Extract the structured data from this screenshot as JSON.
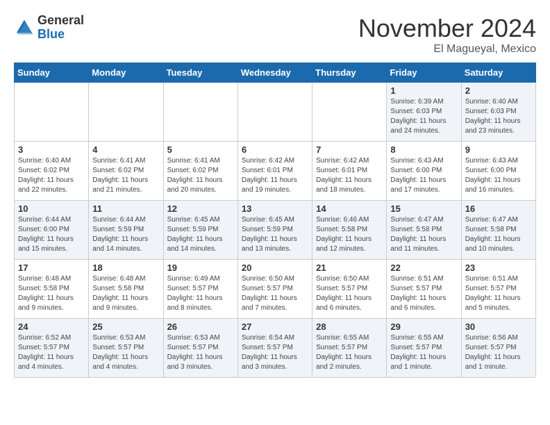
{
  "header": {
    "logo_general": "General",
    "logo_blue": "Blue",
    "month_title": "November 2024",
    "location": "El Magueyal, Mexico"
  },
  "days_of_week": [
    "Sunday",
    "Monday",
    "Tuesday",
    "Wednesday",
    "Thursday",
    "Friday",
    "Saturday"
  ],
  "weeks": [
    [
      {
        "day": "",
        "info": ""
      },
      {
        "day": "",
        "info": ""
      },
      {
        "day": "",
        "info": ""
      },
      {
        "day": "",
        "info": ""
      },
      {
        "day": "",
        "info": ""
      },
      {
        "day": "1",
        "info": "Sunrise: 6:39 AM\nSunset: 6:03 PM\nDaylight: 11 hours and 24 minutes."
      },
      {
        "day": "2",
        "info": "Sunrise: 6:40 AM\nSunset: 6:03 PM\nDaylight: 11 hours and 23 minutes."
      }
    ],
    [
      {
        "day": "3",
        "info": "Sunrise: 6:40 AM\nSunset: 6:02 PM\nDaylight: 11 hours and 22 minutes."
      },
      {
        "day": "4",
        "info": "Sunrise: 6:41 AM\nSunset: 6:02 PM\nDaylight: 11 hours and 21 minutes."
      },
      {
        "day": "5",
        "info": "Sunrise: 6:41 AM\nSunset: 6:02 PM\nDaylight: 11 hours and 20 minutes."
      },
      {
        "day": "6",
        "info": "Sunrise: 6:42 AM\nSunset: 6:01 PM\nDaylight: 11 hours and 19 minutes."
      },
      {
        "day": "7",
        "info": "Sunrise: 6:42 AM\nSunset: 6:01 PM\nDaylight: 11 hours and 18 minutes."
      },
      {
        "day": "8",
        "info": "Sunrise: 6:43 AM\nSunset: 6:00 PM\nDaylight: 11 hours and 17 minutes."
      },
      {
        "day": "9",
        "info": "Sunrise: 6:43 AM\nSunset: 6:00 PM\nDaylight: 11 hours and 16 minutes."
      }
    ],
    [
      {
        "day": "10",
        "info": "Sunrise: 6:44 AM\nSunset: 6:00 PM\nDaylight: 11 hours and 15 minutes."
      },
      {
        "day": "11",
        "info": "Sunrise: 6:44 AM\nSunset: 5:59 PM\nDaylight: 11 hours and 14 minutes."
      },
      {
        "day": "12",
        "info": "Sunrise: 6:45 AM\nSunset: 5:59 PM\nDaylight: 11 hours and 14 minutes."
      },
      {
        "day": "13",
        "info": "Sunrise: 6:45 AM\nSunset: 5:59 PM\nDaylight: 11 hours and 13 minutes."
      },
      {
        "day": "14",
        "info": "Sunrise: 6:46 AM\nSunset: 5:58 PM\nDaylight: 11 hours and 12 minutes."
      },
      {
        "day": "15",
        "info": "Sunrise: 6:47 AM\nSunset: 5:58 PM\nDaylight: 11 hours and 11 minutes."
      },
      {
        "day": "16",
        "info": "Sunrise: 6:47 AM\nSunset: 5:58 PM\nDaylight: 11 hours and 10 minutes."
      }
    ],
    [
      {
        "day": "17",
        "info": "Sunrise: 6:48 AM\nSunset: 5:58 PM\nDaylight: 11 hours and 9 minutes."
      },
      {
        "day": "18",
        "info": "Sunrise: 6:48 AM\nSunset: 5:58 PM\nDaylight: 11 hours and 9 minutes."
      },
      {
        "day": "19",
        "info": "Sunrise: 6:49 AM\nSunset: 5:57 PM\nDaylight: 11 hours and 8 minutes."
      },
      {
        "day": "20",
        "info": "Sunrise: 6:50 AM\nSunset: 5:57 PM\nDaylight: 11 hours and 7 minutes."
      },
      {
        "day": "21",
        "info": "Sunrise: 6:50 AM\nSunset: 5:57 PM\nDaylight: 11 hours and 6 minutes."
      },
      {
        "day": "22",
        "info": "Sunrise: 6:51 AM\nSunset: 5:57 PM\nDaylight: 11 hours and 6 minutes."
      },
      {
        "day": "23",
        "info": "Sunrise: 6:51 AM\nSunset: 5:57 PM\nDaylight: 11 hours and 5 minutes."
      }
    ],
    [
      {
        "day": "24",
        "info": "Sunrise: 6:52 AM\nSunset: 5:57 PM\nDaylight: 11 hours and 4 minutes."
      },
      {
        "day": "25",
        "info": "Sunrise: 6:53 AM\nSunset: 5:57 PM\nDaylight: 11 hours and 4 minutes."
      },
      {
        "day": "26",
        "info": "Sunrise: 6:53 AM\nSunset: 5:57 PM\nDaylight: 11 hours and 3 minutes."
      },
      {
        "day": "27",
        "info": "Sunrise: 6:54 AM\nSunset: 5:57 PM\nDaylight: 11 hours and 3 minutes."
      },
      {
        "day": "28",
        "info": "Sunrise: 6:55 AM\nSunset: 5:57 PM\nDaylight: 11 hours and 2 minutes."
      },
      {
        "day": "29",
        "info": "Sunrise: 6:55 AM\nSunset: 5:57 PM\nDaylight: 11 hours and 1 minute."
      },
      {
        "day": "30",
        "info": "Sunrise: 6:56 AM\nSunset: 5:57 PM\nDaylight: 11 hours and 1 minute."
      }
    ]
  ]
}
